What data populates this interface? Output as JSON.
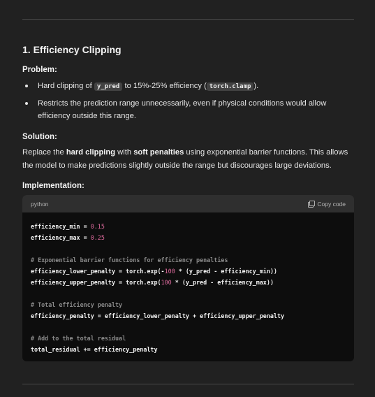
{
  "heading": "1. Efficiency Clipping",
  "problem": {
    "label": "Problem:",
    "bullets": [
      {
        "pre": "Hard clipping of ",
        "code1": "y_pred",
        "mid": " to 15%-25% efficiency (",
        "code2": "torch.clamp",
        "post": ")."
      },
      {
        "text": "Restricts the prediction range unnecessarily, even if physical conditions would allow efficiency outside this range."
      }
    ]
  },
  "solution": {
    "label": "Solution:",
    "text_pre": "Replace the ",
    "bold1": "hard clipping",
    "text_mid": " with ",
    "bold2": "soft penalties",
    "text_post": " using exponential barrier functions. This allows the model to make predictions slightly outside the range but discourages large deviations."
  },
  "implementation": {
    "label": "Implementation:",
    "language": "python",
    "copy_label": "Copy code",
    "lines": [
      {
        "a": "efficiency_min = ",
        "n": "0.15",
        "b": ""
      },
      {
        "a": "efficiency_max = ",
        "n": "0.25",
        "b": ""
      },
      {
        "a": "",
        "n": "",
        "b": ""
      },
      {
        "c": "# Exponential barrier functions for efficiency penalties"
      },
      {
        "a": "efficiency_lower_penalty = torch.exp(-",
        "n": "100",
        "b": " * (y_pred - efficiency_min))"
      },
      {
        "a": "efficiency_upper_penalty = torch.exp(",
        "n": "100",
        "b": " * (y_pred - efficiency_max))"
      },
      {
        "a": "",
        "n": "",
        "b": ""
      },
      {
        "c": "# Total efficiency penalty"
      },
      {
        "a": "efficiency_penalty = efficiency_lower_penalty + efficiency_upper_penalty",
        "n": "",
        "b": ""
      },
      {
        "a": "",
        "n": "",
        "b": ""
      },
      {
        "c": "# Add to the total residual"
      },
      {
        "a": "total_residual += efficiency_penalty",
        "n": "",
        "b": ""
      }
    ]
  },
  "colors": {
    "background": "#212121",
    "code_background": "#0d0d0d",
    "code_header": "#2f2f2f",
    "number": "#e06c9f",
    "comment": "#8a8a8a"
  },
  "icons": {
    "copy": "copy-icon"
  }
}
